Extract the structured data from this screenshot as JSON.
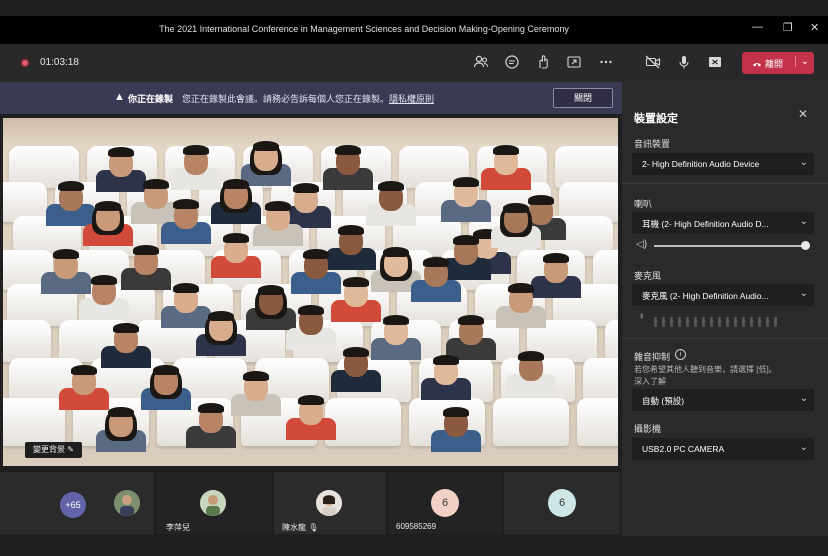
{
  "window": {
    "title": "The 2021 International Conference in Management Sciences and Decision Making-Opening Ceremony",
    "minimize": "—",
    "maximize": "❐",
    "close": "✕"
  },
  "toolbar": {
    "timer": "01:03:18",
    "leave_label": "離開",
    "icons": [
      "people-icon",
      "chat-icon",
      "reactions-icon",
      "share-icon",
      "more-icon",
      "camera-off-icon",
      "mic-icon",
      "share-tray-icon"
    ]
  },
  "banner": {
    "title": "你正在錄製",
    "message": "您正在錄製此會議。請務必告訴每個人您正在錄製。",
    "link": "隱私權原則",
    "close_label": "關閉"
  },
  "stage": {
    "background_chip": "變更背景"
  },
  "strip": {
    "more_count": "+65",
    "tiles": [
      {
        "name": "李萍兒"
      },
      {
        "name": "陳水龍"
      },
      {
        "name": "609585269",
        "initial": "6"
      },
      {
        "initial": "6"
      }
    ]
  },
  "panel": {
    "title": "裝置設定",
    "audio_label": "音訊裝置",
    "audio_value": "2- High Definition Audio Device",
    "speaker_label": "喇叭",
    "speaker_value": "耳機 (2- High Definition Audio D...",
    "speaker_volume": 0.97,
    "mic_label": "麥克風",
    "mic_value": "麥克風 (2- High Definition Audio...",
    "noise_label": "雜音抑制",
    "noise_desc": "若您希望其他人聽到音樂，請選擇 [低]。",
    "noise_more": "深入了解",
    "noise_value": "自動 (預設)",
    "camera_label": "攝影機",
    "camera_value": "USB2.0 PC CAMERA"
  },
  "colors": {
    "accent": "#6264a7",
    "leave": "#c4314b",
    "banner": "#3b3a55"
  }
}
